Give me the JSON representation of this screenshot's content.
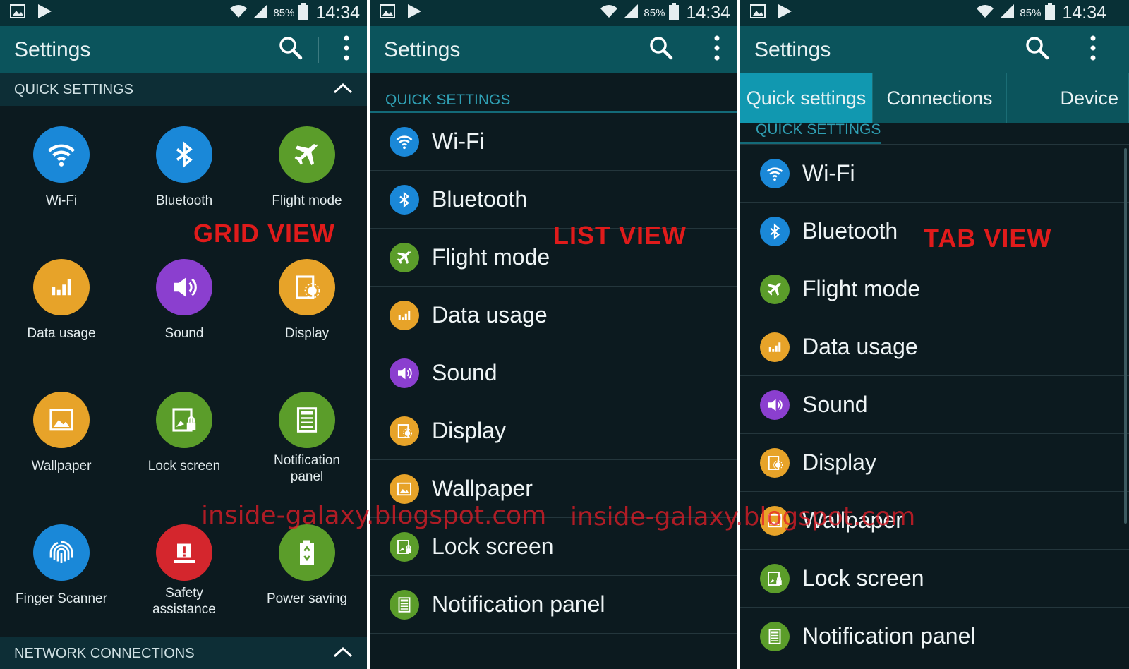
{
  "status_bar": {
    "battery_pct": "85%",
    "time": "14:34",
    "icons": [
      "gallery-icon",
      "play-store-icon",
      "wifi-signal-icon",
      "cell-signal-icon",
      "battery-icon"
    ]
  },
  "colors": {
    "appbar": "#0b545c",
    "statusbar": "#083036",
    "bg": "#0c1a1f",
    "tab_active": "#1198b0",
    "section_text": "#2f9fb3",
    "blue": "#1a88d8",
    "green": "#5b9d2a",
    "orange": "#e7a329",
    "purple": "#8b3fcf",
    "red": "#d4262d",
    "label_red": "#e01b1b"
  },
  "app": {
    "title": "Settings",
    "search_label": "Search",
    "more_label": "More options"
  },
  "grid_view": {
    "overlay_label": "GRID VIEW",
    "section": "QUICK SETTINGS",
    "next_section": "NETWORK CONNECTIONS",
    "items": [
      {
        "label": "Wi-Fi",
        "icon": "wifi-icon",
        "color": "#1a88d8"
      },
      {
        "label": "Bluetooth",
        "icon": "bluetooth-icon",
        "color": "#1a88d8"
      },
      {
        "label": "Flight mode",
        "icon": "airplane-icon",
        "color": "#5b9d2a"
      },
      {
        "label": "Data usage",
        "icon": "data-usage-icon",
        "color": "#e7a329"
      },
      {
        "label": "Sound",
        "icon": "sound-icon",
        "color": "#8b3fcf"
      },
      {
        "label": "Display",
        "icon": "display-icon",
        "color": "#e7a329"
      },
      {
        "label": "Wallpaper",
        "icon": "wallpaper-icon",
        "color": "#e7a329"
      },
      {
        "label": "Lock screen",
        "icon": "lock-screen-icon",
        "color": "#5b9d2a"
      },
      {
        "label": "Notification panel",
        "icon": "notification-panel-icon",
        "color": "#5b9d2a"
      },
      {
        "label": "Finger Scanner",
        "icon": "fingerprint-icon",
        "color": "#1a88d8"
      },
      {
        "label": "Safety assistance",
        "icon": "safety-icon",
        "color": "#d4262d"
      },
      {
        "label": "Power saving",
        "icon": "power-saving-icon",
        "color": "#5b9d2a"
      }
    ]
  },
  "list_view": {
    "overlay_label": "LIST VIEW",
    "section": "QUICK SETTINGS",
    "items": [
      {
        "label": "Wi-Fi",
        "icon": "wifi-icon",
        "color": "#1a88d8"
      },
      {
        "label": "Bluetooth",
        "icon": "bluetooth-icon",
        "color": "#1a88d8"
      },
      {
        "label": "Flight mode",
        "icon": "airplane-icon",
        "color": "#5b9d2a"
      },
      {
        "label": "Data usage",
        "icon": "data-usage-icon",
        "color": "#e7a329"
      },
      {
        "label": "Sound",
        "icon": "sound-icon",
        "color": "#8b3fcf"
      },
      {
        "label": "Display",
        "icon": "display-icon",
        "color": "#e7a329"
      },
      {
        "label": "Wallpaper",
        "icon": "wallpaper-icon",
        "color": "#e7a329"
      },
      {
        "label": "Lock screen",
        "icon": "lock-screen-icon",
        "color": "#5b9d2a"
      },
      {
        "label": "Notification panel",
        "icon": "notification-panel-icon",
        "color": "#5b9d2a"
      }
    ]
  },
  "tab_view": {
    "overlay_label": "TAB VIEW",
    "tabs": [
      "Quick settings",
      "Connections",
      "Device"
    ],
    "active_tab": "Quick settings",
    "section": "QUICK SETTINGS",
    "items": [
      {
        "label": "Wi-Fi",
        "icon": "wifi-icon",
        "color": "#1a88d8"
      },
      {
        "label": "Bluetooth",
        "icon": "bluetooth-icon",
        "color": "#1a88d8"
      },
      {
        "label": "Flight mode",
        "icon": "airplane-icon",
        "color": "#5b9d2a"
      },
      {
        "label": "Data usage",
        "icon": "data-usage-icon",
        "color": "#e7a329"
      },
      {
        "label": "Sound",
        "icon": "sound-icon",
        "color": "#8b3fcf"
      },
      {
        "label": "Display",
        "icon": "display-icon",
        "color": "#e7a329"
      },
      {
        "label": "Wallpaper",
        "icon": "wallpaper-icon",
        "color": "#e7a329"
      },
      {
        "label": "Lock screen",
        "icon": "lock-screen-icon",
        "color": "#5b9d2a"
      },
      {
        "label": "Notification panel",
        "icon": "notification-panel-icon",
        "color": "#5b9d2a"
      }
    ]
  },
  "watermark": "inside-galaxy.blogspot.com"
}
